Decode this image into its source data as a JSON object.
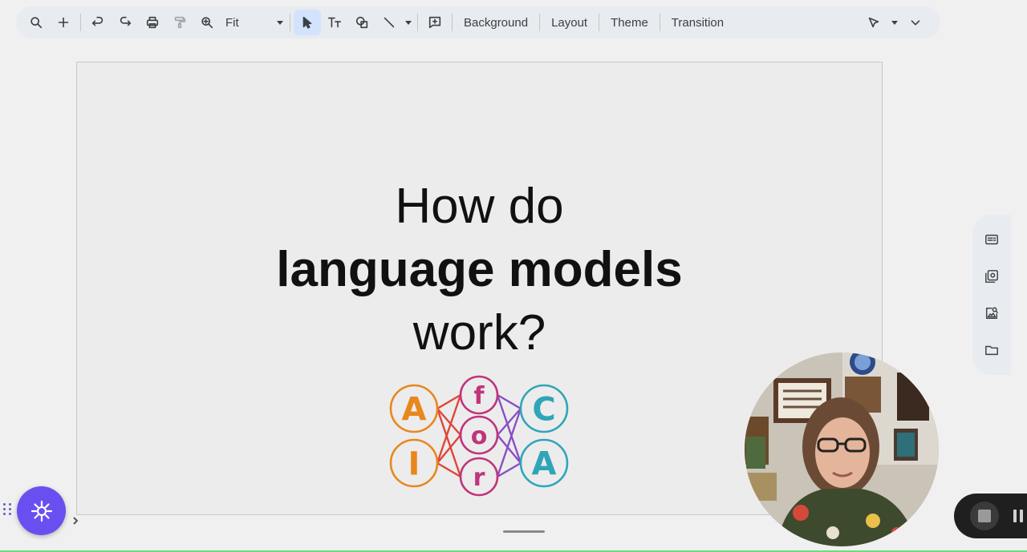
{
  "toolbar": {
    "zoom_value": "Fit",
    "menus": {
      "background": "Background",
      "layout": "Layout",
      "theme": "Theme",
      "transition": "Transition"
    },
    "active_tool": "select"
  },
  "slide": {
    "title_line1": "How do",
    "title_line2": "language models",
    "title_line3": "work?",
    "logo": {
      "left_nodes": [
        "A",
        "I"
      ],
      "middle_nodes": [
        "f",
        "o",
        "r"
      ],
      "right_nodes": [
        "C",
        "A"
      ],
      "colors": {
        "left": "#e8871e",
        "middle": "#c0357a",
        "right": "#2fa5b8",
        "edges_left": "#e0453a",
        "edges_right": "#8a4fc4"
      }
    }
  },
  "side_panel": {
    "icons": [
      "keep-icon",
      "tasks-icon",
      "image-search-icon",
      "folder-icon"
    ]
  },
  "fab": {
    "icon": "sparkle-gear-icon",
    "color": "#6a4ff0"
  },
  "recorder": {
    "icons": [
      "stop-icon",
      "pause-icon"
    ]
  }
}
